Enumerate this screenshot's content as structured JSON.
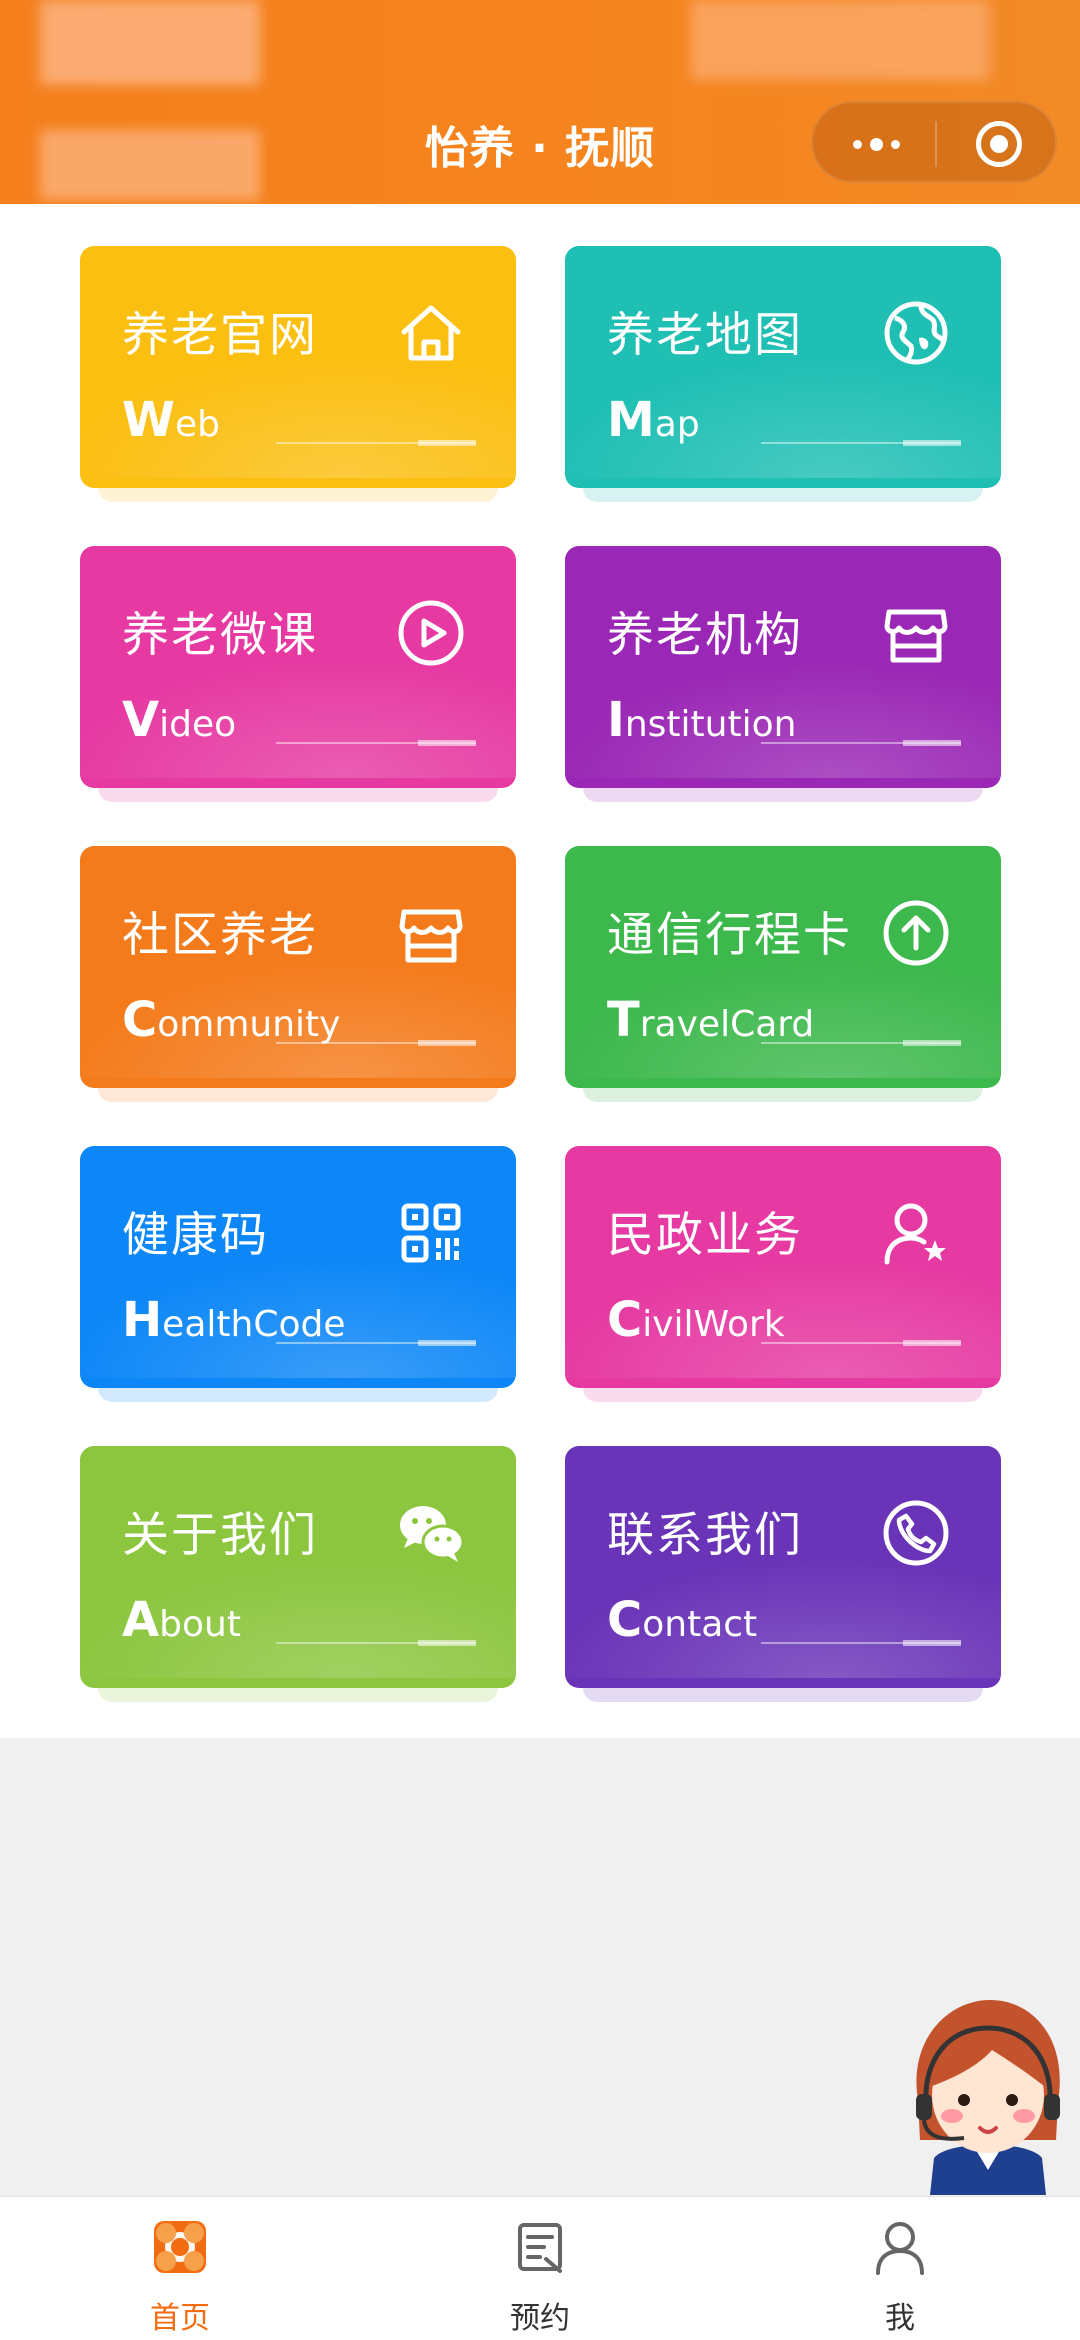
{
  "header": {
    "title": "怡养 · 抚顺",
    "more_icon": "more-dots-icon",
    "close_icon": "target-close-icon"
  },
  "cards": [
    {
      "zh": "养老官网",
      "en_cap": "W",
      "en_rest": "eb",
      "icon": "home-icon",
      "color": "#fbbf12"
    },
    {
      "zh": "养老地图",
      "en_cap": "M",
      "en_rest": "ap",
      "icon": "globe-icon",
      "color": "#1fbfb4"
    },
    {
      "zh": "养老微课",
      "en_cap": "V",
      "en_rest": "ideo",
      "icon": "play-icon",
      "color": "#e63aa2"
    },
    {
      "zh": "养老机构",
      "en_cap": "I",
      "en_rest": "nstitution",
      "icon": "store-icon",
      "color": "#9a27b5"
    },
    {
      "zh": "社区养老",
      "en_cap": "C",
      "en_rest": "ommunity",
      "icon": "store-icon",
      "color": "#f47b1c"
    },
    {
      "zh": "通信行程卡",
      "en_cap": "T",
      "en_rest": "ravelCard",
      "icon": "arrow-up-circle-icon",
      "color": "#3cb84c"
    },
    {
      "zh": "健康码",
      "en_cap": "H",
      "en_rest": "ealthCode",
      "icon": "qr-code-icon",
      "color": "#0d87f7"
    },
    {
      "zh": "民政业务",
      "en_cap": "C",
      "en_rest": "ivilWork",
      "icon": "user-star-icon",
      "color": "#e63aa2"
    },
    {
      "zh": "关于我们",
      "en_cap": "A",
      "en_rest": "bout",
      "icon": "wechat-icon",
      "color": "#8cc63f"
    },
    {
      "zh": "联系我们",
      "en_cap": "C",
      "en_rest": "ontact",
      "icon": "phone-icon",
      "color": "#6a34b8"
    }
  ],
  "tabbar": [
    {
      "label": "首页",
      "icon": "home-grid-icon",
      "active": true
    },
    {
      "label": "预约",
      "icon": "appointment-icon",
      "active": false
    },
    {
      "label": "我",
      "icon": "profile-icon",
      "active": false
    }
  ],
  "colors": {
    "accent": "#f26d12",
    "header": "#f5851f"
  }
}
